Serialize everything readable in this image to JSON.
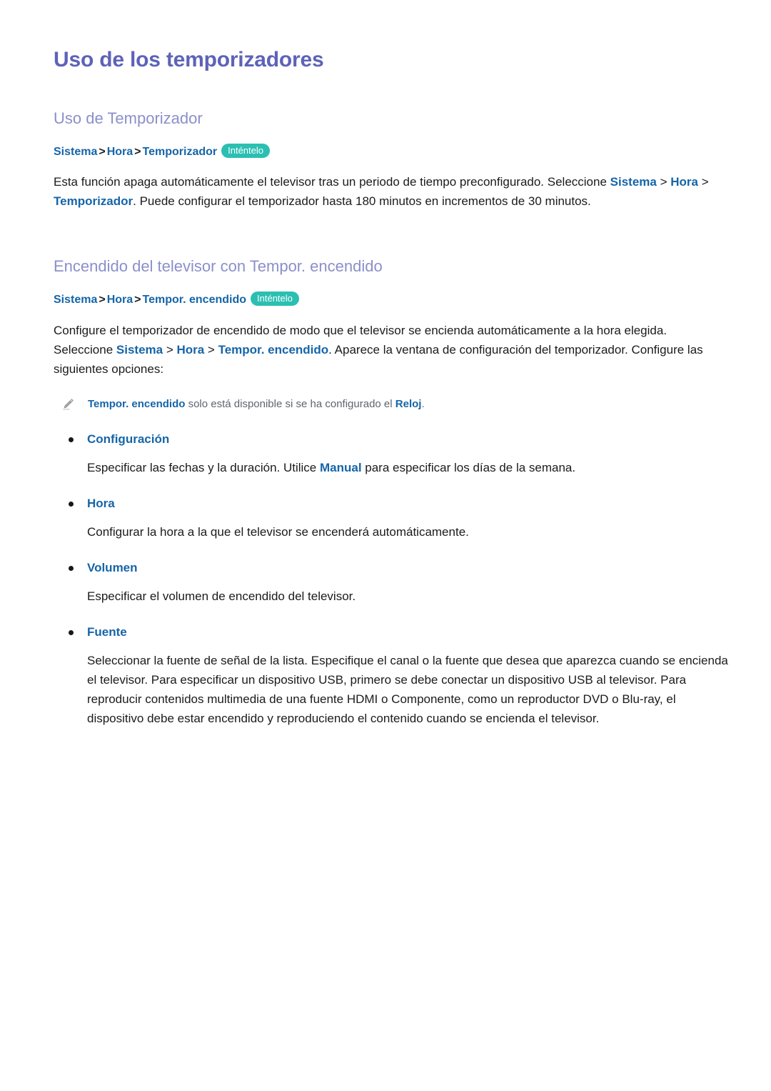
{
  "document": {
    "title": "Uso de los temporizadores",
    "language": "es"
  },
  "colors": {
    "title": "#5d63b8",
    "section_heading": "#8b8fcb",
    "keyword_blue": "#1565a8",
    "badge_teal": "#2bbfb2",
    "note_gray": "#5e6570",
    "body_text": "#1b1b1b",
    "page_background": "#ffffff"
  },
  "sections": [
    {
      "heading": "Uso de Temporizador",
      "breadcrumb": {
        "parts": [
          "Sistema",
          "Hora",
          "Temporizador"
        ],
        "separator": ">",
        "badge": "Inténtelo"
      },
      "paragraph": {
        "runs": [
          {
            "text": "Esta función apaga automáticamente el televisor tras un periodo de tiempo preconfigurado. Seleccione ",
            "style": "normal"
          },
          {
            "text": "Sistema",
            "style": "keyword"
          },
          {
            "text": " > ",
            "style": "normal"
          },
          {
            "text": "Hora",
            "style": "keyword"
          },
          {
            "text": " > ",
            "style": "normal"
          },
          {
            "text": "Temporizador",
            "style": "keyword"
          },
          {
            "text": ". Puede configurar el temporizador hasta 180 minutos en incrementos de 30 minutos.",
            "style": "normal"
          }
        ],
        "plain": "Esta función apaga automáticamente el televisor tras un periodo de tiempo preconfigurado. Seleccione Sistema > Hora > Temporizador. Puede configurar el temporizador hasta 180 minutos en incrementos de 30 minutos."
      }
    },
    {
      "heading": "Encendido del televisor con Tempor. encendido",
      "breadcrumb": {
        "parts": [
          "Sistema",
          "Hora",
          "Tempor. encendido"
        ],
        "separator": ">",
        "badge": "Inténtelo"
      },
      "paragraph": {
        "plain": "Configure el temporizador de encendido de modo que el televisor se encienda automáticamente a la hora elegida. Seleccione Sistema > Hora > Tempor. encendido. Aparece la ventana de configuración del temporizador. Configure las siguientes opciones:"
      },
      "note": {
        "icon": "pencil-icon",
        "keyword_1": "Tempor. encendido",
        "middle": " solo está disponible si se ha configurado el ",
        "keyword_2": "Reloj",
        "end": "."
      },
      "bullets": [
        {
          "label": "Configuración",
          "body_pre": "Especificar las fechas y la duración. Utilice ",
          "body_keyword": "Manual",
          "body_post": " para especificar los días de la semana."
        },
        {
          "label": "Hora",
          "body_pre": "Configurar la hora a la que el televisor se encenderá automáticamente.",
          "body_keyword": "",
          "body_post": ""
        },
        {
          "label": "Volumen",
          "body_pre": "Especificar el volumen de encendido del televisor.",
          "body_keyword": "",
          "body_post": ""
        },
        {
          "label": "Fuente",
          "body_pre": "Seleccionar la fuente de señal de la lista. Especifique el canal o la fuente que desea que aparezca cuando se encienda el televisor. Para especificar un dispositivo USB, primero se debe conectar un dispositivo USB al televisor. Para reproducir contenidos multimedia de una fuente HDMI o Componente, como un reproductor DVD o Blu-ray, el dispositivo debe estar encendido y reproduciendo el contenido cuando se encienda el televisor.",
          "body_keyword": "",
          "body_post": ""
        }
      ]
    }
  ]
}
